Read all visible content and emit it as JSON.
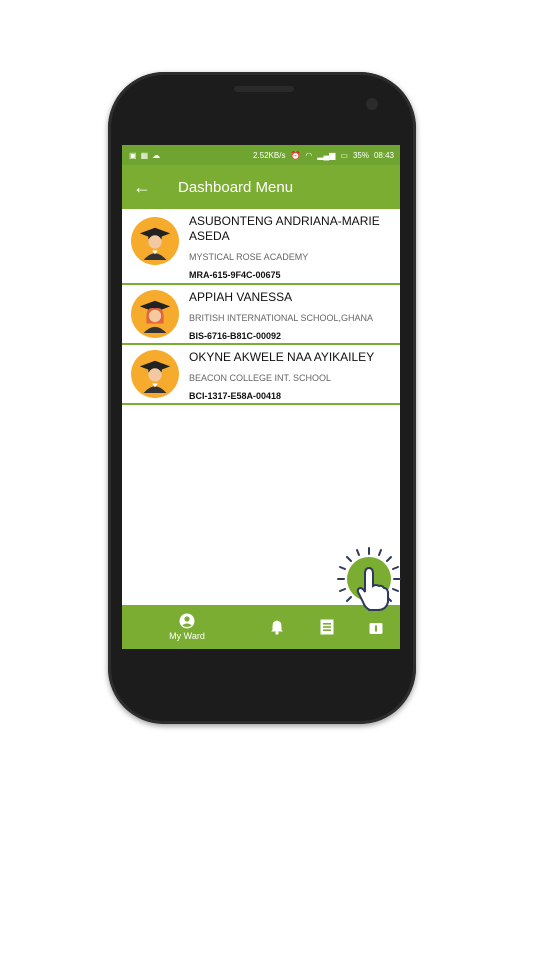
{
  "status_bar": {
    "speed": "2.52KB/s",
    "battery": "35%",
    "time": "08:43"
  },
  "app_bar": {
    "title": "Dashboard Menu"
  },
  "students": [
    {
      "name": "ASUBONTENG ANDRIANA-MARIE ASEDA",
      "school": "MYSTICAL ROSE ACADEMY",
      "code": "MRA-615-9F4C-00675"
    },
    {
      "name": "APPIAH VANESSA",
      "school": "BRITISH INTERNATIONAL SCHOOL,GHANA",
      "code": "BIS-6716-B81C-00092"
    },
    {
      "name": "OKYNE AKWELE NAA AYIKAILEY",
      "school": "BEACON COLLEGE INT. SCHOOL",
      "code": "BCI-1317-E58A-00418"
    }
  ],
  "bottom_nav": {
    "my_ward_label": "My Ward"
  },
  "colors": {
    "brand_green": "#7aad31",
    "avatar_orange": "#f6ab2c"
  }
}
